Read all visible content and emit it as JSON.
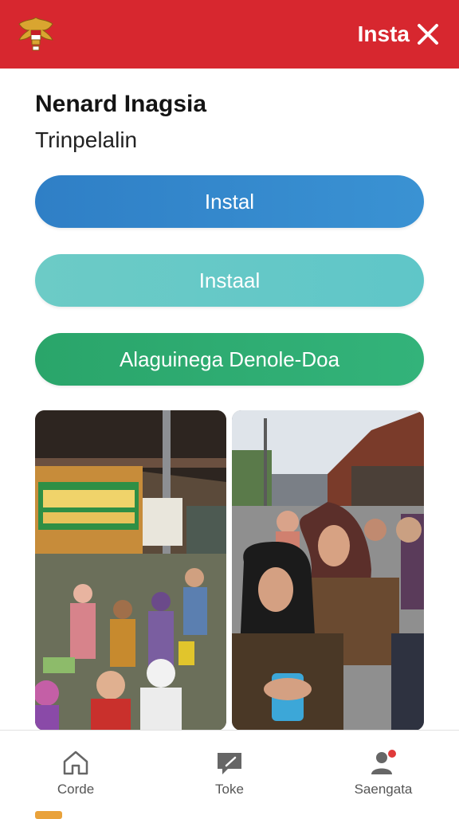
{
  "header": {
    "brand_color": "#d7272f",
    "logo_icon": "garuda-emblem-icon",
    "action_label": "Insta",
    "close_icon": "close-icon"
  },
  "main": {
    "title": "Nenard Inagsia",
    "subtitle": "Trinpelalin",
    "buttons": [
      {
        "label": "Instal",
        "color": "#2f7fc6"
      },
      {
        "label": "Instaal",
        "color": "#6ccbc6"
      },
      {
        "label": "Alaguinega Denole-Doa",
        "color": "#2aa56a"
      }
    ],
    "photos": [
      {
        "icon": "market-stalls-crowd-photo"
      },
      {
        "icon": "women-in-hijab-street-photo"
      }
    ]
  },
  "bottom_nav": {
    "items": [
      {
        "label": "Corde",
        "icon": "home-icon"
      },
      {
        "label": "Toke",
        "icon": "message-icon"
      },
      {
        "label": "Saengata",
        "icon": "user-notification-icon"
      }
    ]
  }
}
